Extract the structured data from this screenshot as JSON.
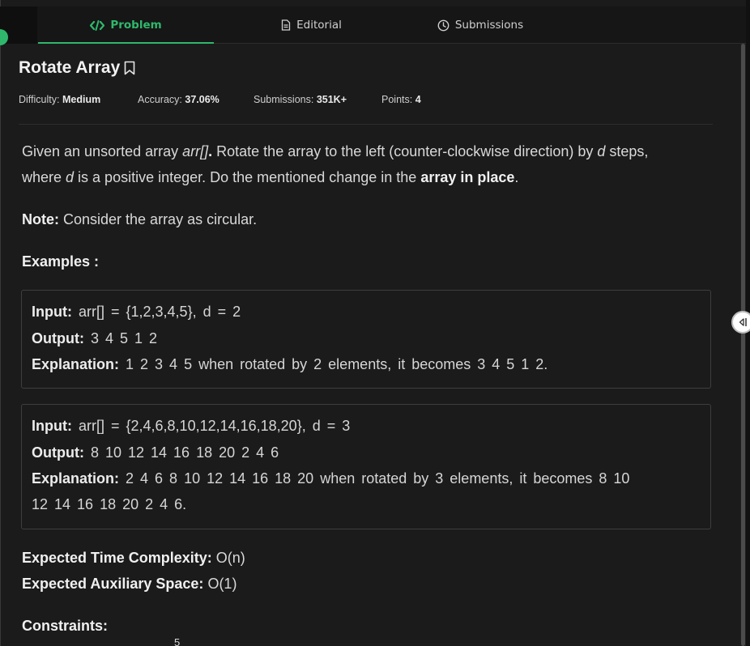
{
  "tabs": [
    {
      "label": "Problem",
      "icon": "code-icon",
      "active": true
    },
    {
      "label": "Editorial",
      "icon": "document-icon",
      "active": false
    },
    {
      "label": "Submissions",
      "icon": "clock-icon",
      "active": false
    }
  ],
  "problem": {
    "title": "Rotate Array",
    "meta": {
      "difficulty_label": "Difficulty:",
      "difficulty_value": "Medium",
      "accuracy_label": "Accuracy:",
      "accuracy_value": "37.06%",
      "submissions_label": "Submissions:",
      "submissions_value": "351K+",
      "points_label": "Points:",
      "points_value": "4"
    },
    "description": {
      "l1_a": "Given an unsorted array ",
      "l1_arr": "arr[]",
      "l1_dot": ".",
      "l1_b": " Rotate the array to the left (counter-clockwise direction) by ",
      "l1_d": "d",
      "l1_c": " steps,",
      "l2_a": "where ",
      "l2_d": "d",
      "l2_b": " is a positive integer. Do the mentioned change in the ",
      "l2_bold": "array in place",
      "l2_c": "."
    },
    "note_label": "Note:",
    "note_text": " Consider the array as circular.",
    "examples_heading": "Examples :",
    "examples": [
      {
        "input_label": "Input:",
        "input": " arr[] = {1,2,3,4,5}, d = 2",
        "output_label": "Output:",
        "output": " 3 4 5 1 2",
        "explanation_label": "Explanation:",
        "explanation": " 1 2 3 4 5  when rotated by 2 elements, it becomes 3 4 5 1 2."
      },
      {
        "input_label": "Input:",
        "input": " arr[] = {2,4,6,8,10,12,14,16,18,20}, d = 3",
        "output_label": "Output:",
        "output": " 8 10 12 14 16 18 20 2 4 6",
        "explanation_label": "Explanation:",
        "explanation": " 2 4 6 8 10 12 14 16 18 20 when rotated by 3 elements, it becomes 8 10",
        "explanation_cont": "12 14 16 18 20 2 4 6."
      }
    ],
    "time_label": "Expected Time Complexity:",
    "time_value": " O(n)",
    "space_label": "Expected Auxiliary Space:",
    "space_value": " O(1)",
    "constraints_heading": "Constraints:",
    "constraints_partial": "5"
  },
  "colors": {
    "accent": "#2fb86c",
    "background": "#1b1b1b"
  }
}
